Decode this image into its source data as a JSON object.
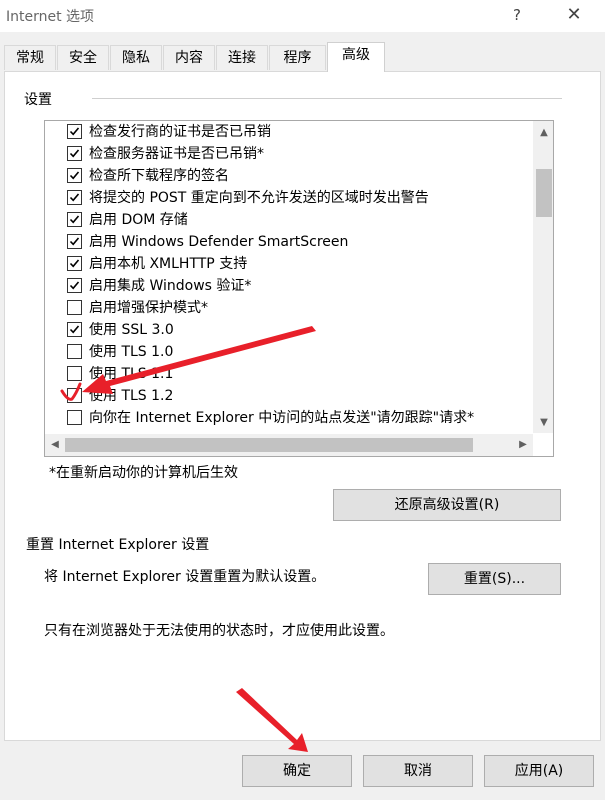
{
  "window": {
    "title": "Internet 选项",
    "help_glyph": "?",
    "close_glyph": "✕"
  },
  "tabs": [
    {
      "label": "常规",
      "active": false
    },
    {
      "label": "安全",
      "active": false
    },
    {
      "label": "隐私",
      "active": false
    },
    {
      "label": "内容",
      "active": false
    },
    {
      "label": "连接",
      "active": false
    },
    {
      "label": "程序",
      "active": false
    },
    {
      "label": "高级",
      "active": true
    }
  ],
  "settings": {
    "group_label": "设置",
    "items": [
      {
        "label": "检查发行商的证书是否已吊销",
        "checked": true
      },
      {
        "label": "检查服务器证书是否已吊销*",
        "checked": true
      },
      {
        "label": "检查所下载程序的签名",
        "checked": true
      },
      {
        "label": "将提交的 POST 重定向到不允许发送的区域时发出警告",
        "checked": true
      },
      {
        "label": "启用 DOM 存储",
        "checked": true
      },
      {
        "label": "启用 Windows Defender SmartScreen",
        "checked": true
      },
      {
        "label": "启用本机 XMLHTTP 支持",
        "checked": true
      },
      {
        "label": "启用集成 Windows 验证*",
        "checked": true
      },
      {
        "label": "启用增强保护模式*",
        "checked": false
      },
      {
        "label": "使用 SSL 3.0",
        "checked": true
      },
      {
        "label": "使用 TLS 1.0",
        "checked": false
      },
      {
        "label": "使用 TLS 1.1",
        "checked": false
      },
      {
        "label": "使用 TLS 1.2",
        "checked": false
      },
      {
        "label": "向你在 Internet Explorer 中访问的站点发送\"请勿跟踪\"请求*",
        "checked": false
      }
    ],
    "restart_note": "*在重新启动你的计算机后生效",
    "restore_button": "还原高级设置(R)"
  },
  "reset": {
    "title": "重置 Internet Explorer 设置",
    "description": "将 Internet Explorer 设置重置为默认设置。",
    "button": "重置(S)...",
    "note": "只有在浏览器处于无法使用的状态时，才应使用此设置。"
  },
  "footer": {
    "ok": "确定",
    "cancel": "取消",
    "apply": "应用(A)"
  },
  "annotations": {
    "color": "#e8202a"
  }
}
